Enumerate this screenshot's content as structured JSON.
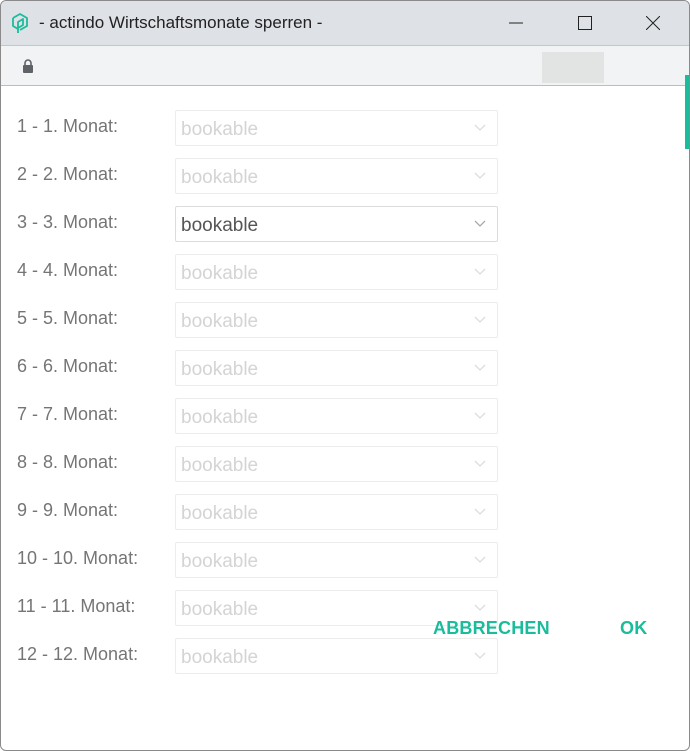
{
  "window": {
    "title": "- actindo Wirtschaftsmonate sperren -"
  },
  "months": [
    {
      "label": "1 - 1. Monat:",
      "value": "bookable",
      "enabled": false
    },
    {
      "label": "2 - 2. Monat:",
      "value": "bookable",
      "enabled": false
    },
    {
      "label": "3 - 3. Monat:",
      "value": "bookable",
      "enabled": true
    },
    {
      "label": "4 - 4. Monat:",
      "value": "bookable",
      "enabled": false
    },
    {
      "label": "5 - 5. Monat:",
      "value": "bookable",
      "enabled": false
    },
    {
      "label": "6 - 6. Monat:",
      "value": "bookable",
      "enabled": false
    },
    {
      "label": "7 - 7. Monat:",
      "value": "bookable",
      "enabled": false
    },
    {
      "label": "8 - 8. Monat:",
      "value": "bookable",
      "enabled": false
    },
    {
      "label": "9 - 9. Monat:",
      "value": "bookable",
      "enabled": false
    },
    {
      "label": "10 - 10. Monat:",
      "value": "bookable",
      "enabled": false
    },
    {
      "label": "11 - 11. Monat:",
      "value": "bookable",
      "enabled": false
    },
    {
      "label": "12 - 12. Monat:",
      "value": "bookable",
      "enabled": false
    }
  ],
  "buttons": {
    "cancel": "ABBRECHEN",
    "ok": "OK"
  },
  "colors": {
    "accent": "#1abc9c"
  }
}
